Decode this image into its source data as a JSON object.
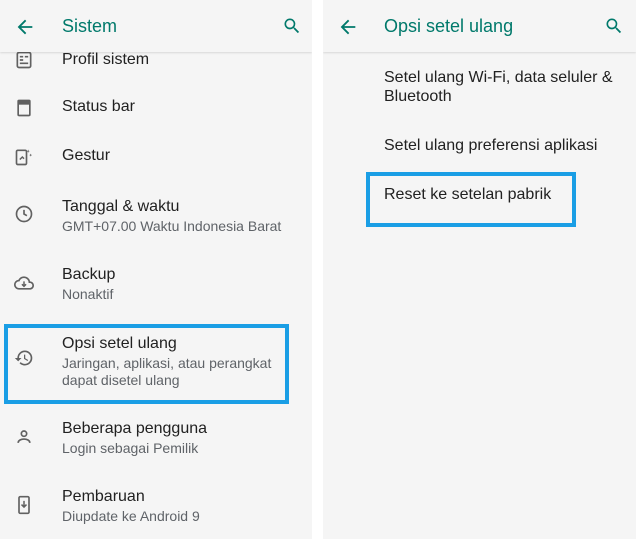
{
  "left_panel": {
    "title": "Sistem",
    "items": [
      {
        "icon": "system-profile-icon",
        "title": "Profil sistem",
        "subtitle": ""
      },
      {
        "icon": "status-bar-icon",
        "title": "Status bar",
        "subtitle": ""
      },
      {
        "icon": "gesture-icon",
        "title": "Gestur",
        "subtitle": ""
      },
      {
        "icon": "clock-icon",
        "title": "Tanggal & waktu",
        "subtitle": "GMT+07.00 Waktu Indonesia Barat"
      },
      {
        "icon": "cloud-backup-icon",
        "title": "Backup",
        "subtitle": "Nonaktif"
      },
      {
        "icon": "restore-icon",
        "title": "Opsi setel ulang",
        "subtitle": "Jaringan, aplikasi, atau perangkat dapat disetel ulang"
      },
      {
        "icon": "person-icon",
        "title": "Beberapa pengguna",
        "subtitle": "Login sebagai Pemilik"
      },
      {
        "icon": "system-update-icon",
        "title": "Pembaruan",
        "subtitle": "Diupdate ke Android 9"
      }
    ]
  },
  "right_panel": {
    "title": "Opsi setel ulang",
    "options": [
      "Setel ulang Wi-Fi, data seluler & Bluetooth",
      "Setel ulang preferensi aplikasi",
      "Reset ke setelan pabrik"
    ]
  },
  "colors": {
    "accent": "#00796b",
    "highlight": "#1a9ee5",
    "background": "#f5f5f5",
    "text_primary": "#212121",
    "text_secondary": "#5f6368"
  }
}
